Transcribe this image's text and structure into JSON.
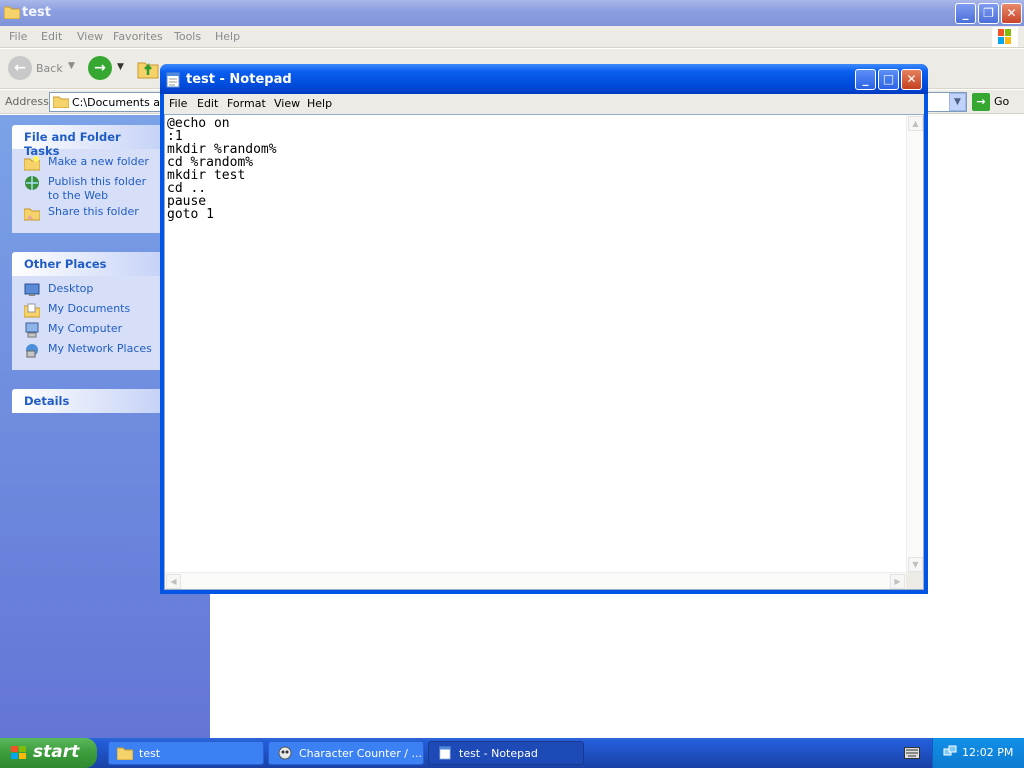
{
  "explorer": {
    "title": "test",
    "menu": [
      "File",
      "Edit",
      "View",
      "Favorites",
      "Tools",
      "Help"
    ],
    "toolbar": {
      "back_label": "Back"
    },
    "address": {
      "label": "Address",
      "value": "C:\\Documents and",
      "go_label": "Go"
    },
    "task_pane": {
      "file_tasks": {
        "title": "File and Folder Tasks",
        "items": [
          "Make a new folder",
          "Publish this folder to the Web",
          "Share this folder"
        ]
      },
      "other_places": {
        "title": "Other Places",
        "items": [
          "Desktop",
          "My Documents",
          "My Computer",
          "My Network Places"
        ]
      },
      "details": {
        "title": "Details"
      }
    }
  },
  "notepad": {
    "title": "test - Notepad",
    "menu": [
      "File",
      "Edit",
      "Format",
      "View",
      "Help"
    ],
    "content": "@echo on\n:1\nmkdir %random%\ncd %random%\nmkdir test\ncd ..\npause\ngoto 1"
  },
  "taskbar": {
    "start_label": "start",
    "buttons": [
      "test",
      "Character Counter / ...",
      "test - Notepad"
    ],
    "clock": "12:02 PM"
  },
  "colors": {
    "xp_blue": "#0055e5",
    "task_link": "#215dc6",
    "start_green": "#3c9c3c"
  }
}
